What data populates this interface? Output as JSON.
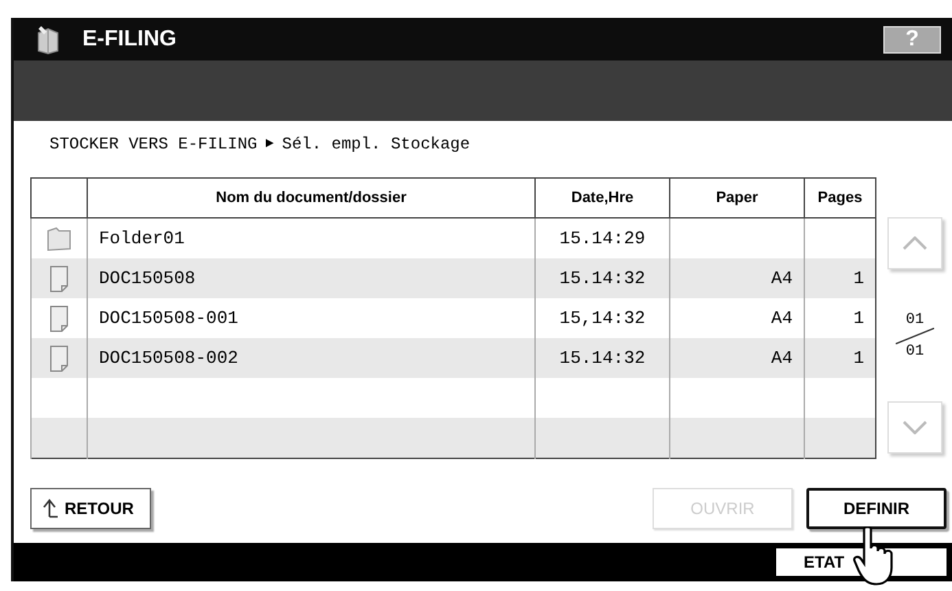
{
  "window": {
    "title": "E-FILING",
    "help_button": "?"
  },
  "breadcrumb": {
    "path": "STOCKER VERS E-FILING",
    "separator": "►",
    "current": "Sél. empl. Stockage"
  },
  "table": {
    "columns": [
      "Nom du document/dossier",
      "Date,Hre",
      "Paper",
      "Pages"
    ],
    "rows": [
      {
        "kind": "folder",
        "name": "Folder01",
        "date": "15.14:29",
        "paper": "",
        "pages": ""
      },
      {
        "kind": "document",
        "name": "DOC150508",
        "date": "15.14:32",
        "paper": "A4",
        "pages": "1"
      },
      {
        "kind": "document",
        "name": "DOC150508-001",
        "date": "15,14:32",
        "paper": "A4",
        "pages": "1"
      },
      {
        "kind": "document",
        "name": "DOC150508-002",
        "date": "15.14:32",
        "paper": "A4",
        "pages": "1"
      },
      {
        "kind": "empty"
      },
      {
        "kind": "empty"
      }
    ]
  },
  "pager": {
    "current": "01",
    "total": "01"
  },
  "buttons": [
    {
      "label": "RETOUR",
      "disabled": false,
      "selected": false
    },
    {
      "label": "OUVRIR",
      "disabled": true,
      "selected": false
    },
    {
      "label": "DEFINIR",
      "disabled": false,
      "selected": true
    }
  ],
  "status_bar": {
    "button": "ETAT"
  }
}
